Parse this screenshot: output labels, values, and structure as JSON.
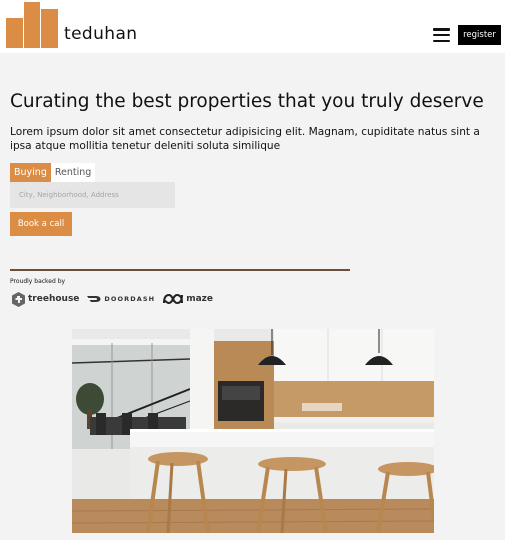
{
  "header": {
    "brand": "teduhan",
    "register_label": "register",
    "brand_color": "#db8d45"
  },
  "hero": {
    "title": "Curating the best properties that you truly deserve",
    "description": "Lorem ipsum dolor sit amet consectetur adipisicing elit. Magnam, cupiditate natus sint a ipsa atque mollitia tenetur deleniti soluta similique"
  },
  "search": {
    "tabs": [
      {
        "label": "Buying",
        "active": true
      },
      {
        "label": "Renting",
        "active": false
      }
    ],
    "placeholder": "City, Neighborhood, Address"
  },
  "cta": {
    "book_label": "Book a call"
  },
  "backed": {
    "label": "Proudly backed by",
    "backers": [
      {
        "name": "treehouse",
        "icon": "treehouse-icon"
      },
      {
        "name": "DOORDASH",
        "icon": "doordash-icon"
      },
      {
        "name": "maze",
        "icon": "maze-icon"
      }
    ]
  }
}
